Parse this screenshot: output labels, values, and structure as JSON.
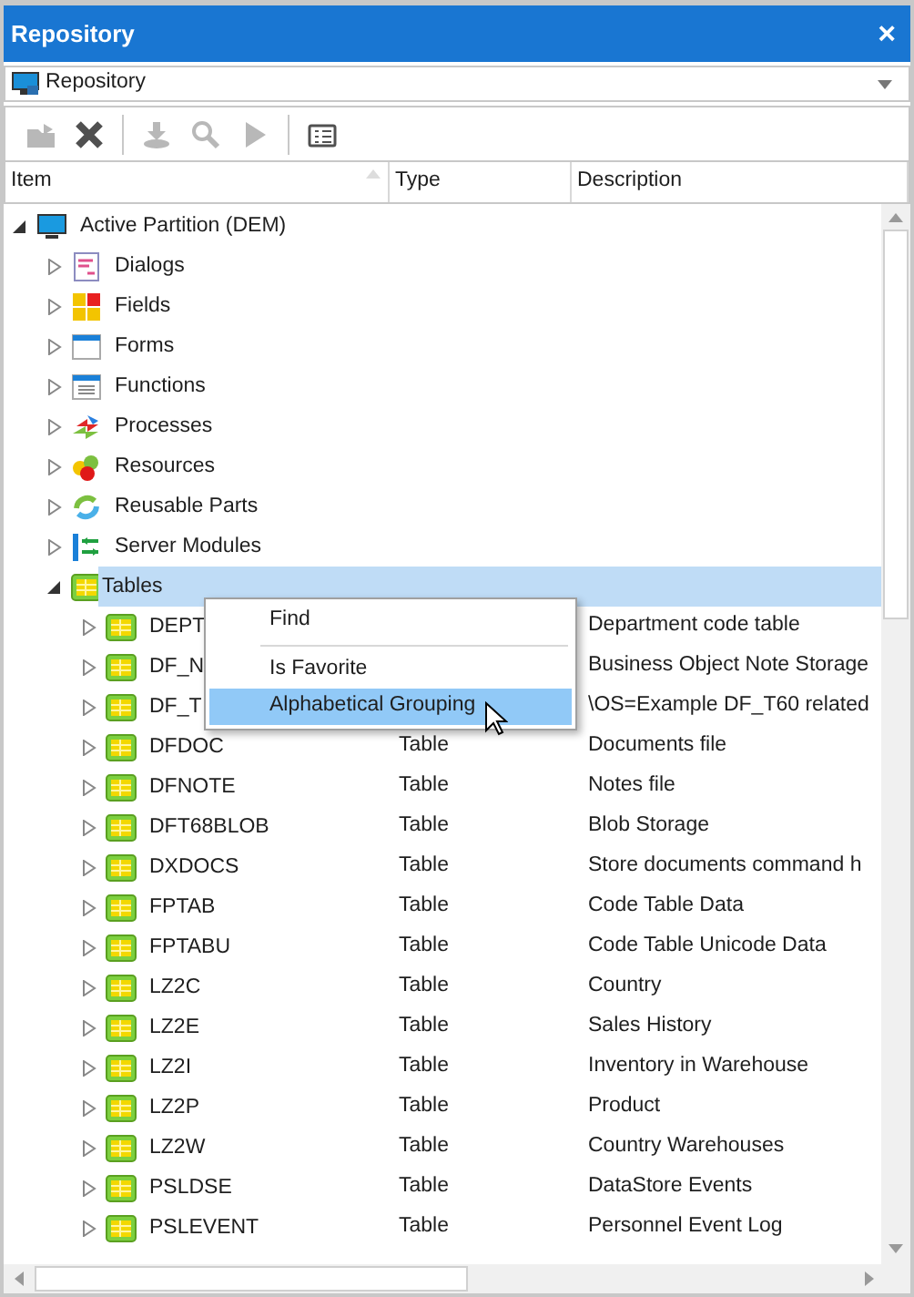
{
  "window": {
    "title": "Repository",
    "close": "×"
  },
  "location": {
    "value": "Repository"
  },
  "toolbar": [
    {
      "kind": "open",
      "disabled": true
    },
    {
      "kind": "delete",
      "disabled": false
    },
    {
      "kind": "separator"
    },
    {
      "kind": "import",
      "disabled": true
    },
    {
      "kind": "search",
      "disabled": true
    },
    {
      "kind": "run",
      "disabled": true
    },
    {
      "kind": "separator"
    },
    {
      "kind": "properties",
      "disabled": false
    }
  ],
  "table": {
    "columns": [
      "Item",
      "Type",
      "Description"
    ],
    "tree": [
      {
        "name": "Active Partition (DEM)",
        "kind": "partition",
        "expanded": true,
        "selected": false,
        "children": [
          {
            "name": "Dialogs",
            "kind": "dialogs",
            "expanded": false,
            "selected": false
          },
          {
            "name": "Fields",
            "kind": "fields",
            "expanded": false,
            "selected": false
          },
          {
            "name": "Forms",
            "kind": "forms",
            "expanded": false,
            "selected": false
          },
          {
            "name": "Functions",
            "kind": "functions",
            "expanded": false,
            "selected": false
          },
          {
            "name": "Processes",
            "kind": "processes",
            "expanded": false,
            "selected": false
          },
          {
            "name": "Resources",
            "kind": "resources",
            "expanded": false,
            "selected": false
          },
          {
            "name": "Reusable Parts",
            "kind": "reusable",
            "expanded": false,
            "selected": false
          },
          {
            "name": "Server Modules",
            "kind": "server",
            "expanded": false,
            "selected": false
          },
          {
            "name": "Tables",
            "kind": "table",
            "expanded": true,
            "selected": true,
            "children": [
              {
                "name": "DEPT",
                "kind": "table",
                "expanded": false,
                "selected": false,
                "description": "Department code table"
              },
              {
                "name": "DF_N",
                "kind": "table",
                "expanded": false,
                "selected": false,
                "description": "Business Object Note Storage"
              },
              {
                "name": "DF_T",
                "kind": "table",
                "expanded": false,
                "selected": false,
                "description": "\\OS=Example DF_T60 related"
              },
              {
                "name": "DFDOC",
                "kind": "table",
                "expanded": false,
                "selected": false,
                "type": "Table",
                "description": "Documents file"
              },
              {
                "name": "DFNOTE",
                "kind": "table",
                "expanded": false,
                "selected": false,
                "type": "Table",
                "description": "Notes file"
              },
              {
                "name": "DFT68BLOB",
                "kind": "table",
                "expanded": false,
                "selected": false,
                "type": "Table",
                "description": "Blob Storage"
              },
              {
                "name": "DXDOCS",
                "kind": "table",
                "expanded": false,
                "selected": false,
                "type": "Table",
                "description": "Store documents command h"
              },
              {
                "name": "FPTAB",
                "kind": "table",
                "expanded": false,
                "selected": false,
                "type": "Table",
                "description": "Code Table Data"
              },
              {
                "name": "FPTABU",
                "kind": "table",
                "expanded": false,
                "selected": false,
                "type": "Table",
                "description": "Code Table Unicode Data"
              },
              {
                "name": "LZ2C",
                "kind": "table",
                "expanded": false,
                "selected": false,
                "type": "Table",
                "description": "Country"
              },
              {
                "name": "LZ2E",
                "kind": "table",
                "expanded": false,
                "selected": false,
                "type": "Table",
                "description": "Sales History"
              },
              {
                "name": "LZ2I",
                "kind": "table",
                "expanded": false,
                "selected": false,
                "type": "Table",
                "description": "Inventory in Warehouse"
              },
              {
                "name": "LZ2P",
                "kind": "table",
                "expanded": false,
                "selected": false,
                "type": "Table",
                "description": "Product"
              },
              {
                "name": "LZ2W",
                "kind": "table",
                "expanded": false,
                "selected": false,
                "type": "Table",
                "description": "Country Warehouses"
              },
              {
                "name": "PSLDSE",
                "kind": "table",
                "expanded": false,
                "selected": false,
                "type": "Table",
                "description": "DataStore Events"
              },
              {
                "name": "PSLEVENT",
                "kind": "table",
                "expanded": false,
                "selected": false,
                "type": "Table",
                "description": "Personnel Event Log"
              }
            ]
          }
        ]
      }
    ]
  },
  "context_menu": [
    {
      "kind": "item",
      "label": "Find",
      "selected": false
    },
    {
      "kind": "separator"
    },
    {
      "kind": "item",
      "label": "Is Favorite",
      "selected": false
    },
    {
      "kind": "item",
      "label": "Alphabetical Grouping",
      "selected": true
    }
  ]
}
